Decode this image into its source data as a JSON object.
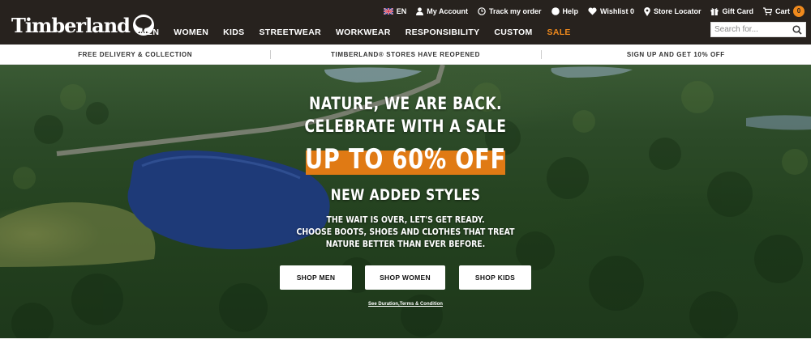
{
  "header": {
    "logo_text": "Timberland",
    "nav": [
      {
        "label": "MEN"
      },
      {
        "label": "WOMEN"
      },
      {
        "label": "KIDS"
      },
      {
        "label": "STREETWEAR"
      },
      {
        "label": "WORKWEAR"
      },
      {
        "label": "RESPONSIBILITY"
      },
      {
        "label": "CUSTOM"
      },
      {
        "label": "SALE"
      }
    ],
    "utility": {
      "language": "EN",
      "my_account": "My Account",
      "track_order": "Track my order",
      "help": "Help",
      "wishlist": "Wishlist 0",
      "store_locator": "Store Locator",
      "gift_card": "Gift Card",
      "cart": "Cart",
      "cart_count": "0"
    },
    "search": {
      "placeholder": "Search for..."
    }
  },
  "promo_strip": [
    {
      "text": "FREE DELIVERY & COLLECTION"
    },
    {
      "text": "TIMBERLAND® STORES HAVE REOPENED"
    },
    {
      "text": "SIGN UP AND GET 10% OFF"
    }
  ],
  "hero": {
    "line1": "NATURE, WE ARE BACK.",
    "line2": "CELEBRATE WITH A SALE",
    "offer": "UP TO 60% OFF",
    "subhead": "NEW ADDED STYLES",
    "desc": [
      "THE WAIT IS OVER, LET'S GET READY.",
      "CHOOSE BOOTS, SHOES AND CLOTHES THAT TREAT",
      "NATURE BETTER THAN EVER BEFORE."
    ],
    "buttons": {
      "men": "SHOP MEN",
      "women": "SHOP WOMEN",
      "kids": "SHOP KIDS"
    },
    "terms": "See Duration,Terms & Condition"
  },
  "colors": {
    "header_bg": "#27221e",
    "accent_orange": "#e07a14",
    "sale_orange": "#f08a1d"
  }
}
